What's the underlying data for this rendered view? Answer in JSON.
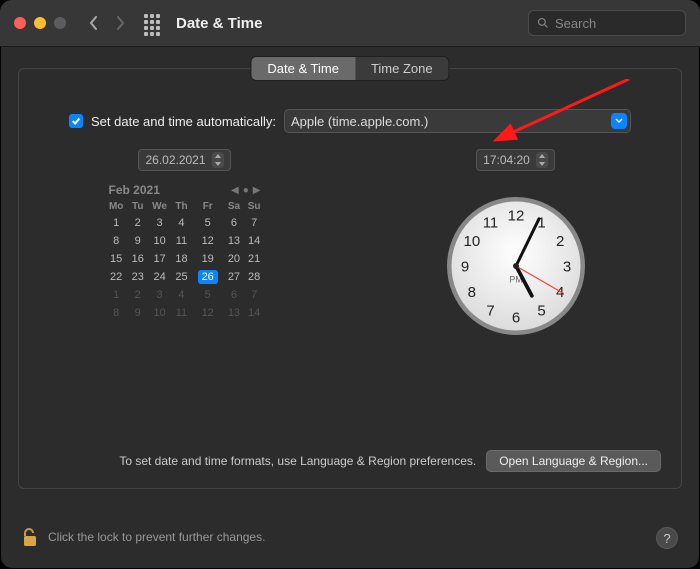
{
  "window": {
    "title": "Date & Time"
  },
  "search": {
    "placeholder": "Search"
  },
  "tabs": {
    "datetime": "Date & Time",
    "timezone": "Time Zone"
  },
  "auto": {
    "label": "Set date and time automatically:",
    "server": "Apple (time.apple.com.)"
  },
  "date": {
    "stepper_value": "26.02.2021",
    "month_year": "Feb 2021",
    "weekdays": [
      "Mo",
      "Tu",
      "We",
      "Th",
      "Fr",
      "Sa",
      "Su"
    ],
    "grid": [
      [
        {
          "d": "1"
        },
        {
          "d": "2"
        },
        {
          "d": "3"
        },
        {
          "d": "4"
        },
        {
          "d": "5"
        },
        {
          "d": "6"
        },
        {
          "d": "7"
        }
      ],
      [
        {
          "d": "8"
        },
        {
          "d": "9"
        },
        {
          "d": "10"
        },
        {
          "d": "11"
        },
        {
          "d": "12"
        },
        {
          "d": "13"
        },
        {
          "d": "14"
        }
      ],
      [
        {
          "d": "15"
        },
        {
          "d": "16"
        },
        {
          "d": "17"
        },
        {
          "d": "18"
        },
        {
          "d": "19"
        },
        {
          "d": "20"
        },
        {
          "d": "21"
        }
      ],
      [
        {
          "d": "22"
        },
        {
          "d": "23"
        },
        {
          "d": "24"
        },
        {
          "d": "25"
        },
        {
          "d": "26",
          "sel": true
        },
        {
          "d": "27"
        },
        {
          "d": "28"
        }
      ],
      [
        {
          "d": "1",
          "dim": true
        },
        {
          "d": "2",
          "dim": true
        },
        {
          "d": "3",
          "dim": true
        },
        {
          "d": "4",
          "dim": true
        },
        {
          "d": "5",
          "dim": true
        },
        {
          "d": "6",
          "dim": true
        },
        {
          "d": "7",
          "dim": true
        }
      ],
      [
        {
          "d": "8",
          "dim": true
        },
        {
          "d": "9",
          "dim": true
        },
        {
          "d": "10",
          "dim": true
        },
        {
          "d": "11",
          "dim": true
        },
        {
          "d": "12",
          "dim": true
        },
        {
          "d": "13",
          "dim": true
        },
        {
          "d": "14",
          "dim": true
        }
      ]
    ]
  },
  "time": {
    "stepper_value": "17:04:20",
    "ampm": "PM",
    "hour": 17,
    "minute": 4,
    "second": 20
  },
  "footer": {
    "hint": "To set date and time formats, use Language & Region preferences.",
    "button": "Open Language & Region..."
  },
  "lock": {
    "text": "Click the lock to prevent further changes."
  },
  "help": {
    "label": "?"
  }
}
